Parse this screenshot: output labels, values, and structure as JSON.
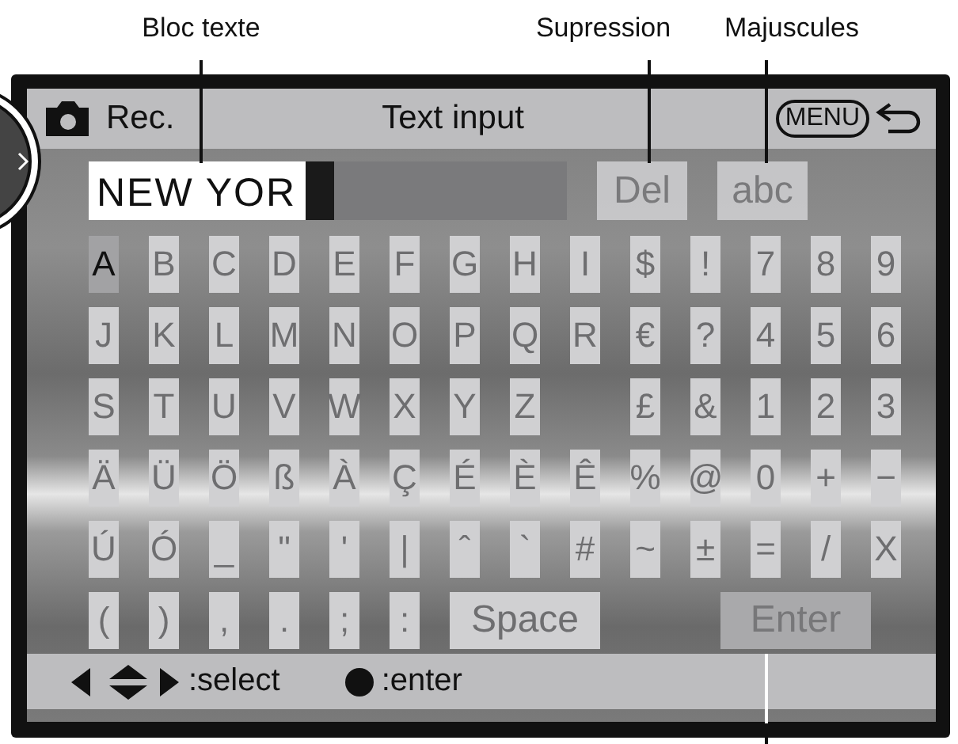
{
  "annotations": [
    {
      "text": "Bloc texte"
    },
    {
      "text": "Supression"
    },
    {
      "text": "Majuscules"
    }
  ],
  "header": {
    "mode": "Rec.",
    "title": "Text input",
    "menu_button": "MENU"
  },
  "text_field": {
    "value": "NEW YOR"
  },
  "edit_buttons": [
    {
      "label": "Del"
    },
    {
      "label": "abc"
    }
  ],
  "keys": [
    [
      {
        "label": "A",
        "selected": true
      },
      {
        "label": "B",
        "selected": false
      },
      {
        "label": "C",
        "selected": false
      },
      {
        "label": "D",
        "selected": false
      },
      {
        "label": "E",
        "selected": false
      },
      {
        "label": "F",
        "selected": false
      },
      {
        "label": "G",
        "selected": false
      },
      {
        "label": "H",
        "selected": false
      },
      {
        "label": "I",
        "selected": false
      },
      {
        "label": "$",
        "selected": false
      },
      {
        "label": "!",
        "selected": false
      },
      {
        "label": "7",
        "selected": false
      },
      {
        "label": "8",
        "selected": false
      },
      {
        "label": "9",
        "selected": false
      }
    ],
    [
      {
        "label": "J",
        "selected": false
      },
      {
        "label": "K",
        "selected": false
      },
      {
        "label": "L",
        "selected": false
      },
      {
        "label": "M",
        "selected": false
      },
      {
        "label": "N",
        "selected": false
      },
      {
        "label": "O",
        "selected": false
      },
      {
        "label": "P",
        "selected": false
      },
      {
        "label": "Q",
        "selected": false
      },
      {
        "label": "R",
        "selected": false
      },
      {
        "label": "€",
        "selected": false
      },
      {
        "label": "?",
        "selected": false
      },
      {
        "label": "4",
        "selected": false
      },
      {
        "label": "5",
        "selected": false
      },
      {
        "label": "6",
        "selected": false
      }
    ],
    [
      {
        "label": "S",
        "selected": false
      },
      {
        "label": "T",
        "selected": false
      },
      {
        "label": "U",
        "selected": false
      },
      {
        "label": "V",
        "selected": false
      },
      {
        "label": "W",
        "selected": false
      },
      {
        "label": "X",
        "selected": false
      },
      {
        "label": "Y",
        "selected": false
      },
      {
        "label": "Z",
        "selected": false
      },
      {
        "label": "£",
        "selected": false,
        "kind": "char_at_10"
      },
      {
        "label": "&",
        "selected": false
      },
      {
        "label": "1",
        "selected": false
      },
      {
        "label": "2",
        "selected": false
      },
      {
        "label": "3",
        "selected": false
      }
    ],
    [
      {
        "label": "Ä",
        "selected": false
      },
      {
        "label": "Ü",
        "selected": false
      },
      {
        "label": "Ö",
        "selected": false
      },
      {
        "label": "ß",
        "selected": false
      },
      {
        "label": "À",
        "selected": false
      },
      {
        "label": "Ç",
        "selected": false
      },
      {
        "label": "É",
        "selected": false
      },
      {
        "label": "È",
        "selected": false
      },
      {
        "label": "Ê",
        "selected": false
      },
      {
        "label": "%",
        "selected": false
      },
      {
        "label": "@",
        "selected": false
      },
      {
        "label": "0",
        "selected": false
      },
      {
        "label": "+",
        "selected": false
      },
      {
        "label": "−",
        "selected": false
      }
    ],
    [
      {
        "label": "Ú",
        "selected": false
      },
      {
        "label": "Ó",
        "selected": false
      },
      {
        "label": "_",
        "selected": false
      },
      {
        "label": "\"",
        "selected": false
      },
      {
        "label": "'",
        "selected": false
      },
      {
        "label": "|",
        "selected": false
      },
      {
        "label": "ˆ",
        "selected": false
      },
      {
        "label": "`",
        "selected": false
      },
      {
        "label": "#",
        "selected": false
      },
      {
        "label": "~",
        "selected": false
      },
      {
        "label": "±",
        "selected": false
      },
      {
        "label": "=",
        "selected": false
      },
      {
        "label": "/",
        "selected": false
      },
      {
        "label": "X",
        "selected": false
      }
    ],
    [
      {
        "label": "(",
        "selected": false
      },
      {
        "label": ")",
        "selected": false
      },
      {
        "label": ",",
        "selected": false
      },
      {
        "label": ".",
        "selected": false
      },
      {
        "label": ";",
        "selected": false
      },
      {
        "label": ":",
        "selected": false
      },
      {
        "label": "Space",
        "selected": false,
        "kind": "space"
      },
      {
        "label": "Enter",
        "selected": false,
        "kind": "enter"
      }
    ]
  ],
  "footer": {
    "select_hint": ":select",
    "enter_hint": ":enter"
  }
}
